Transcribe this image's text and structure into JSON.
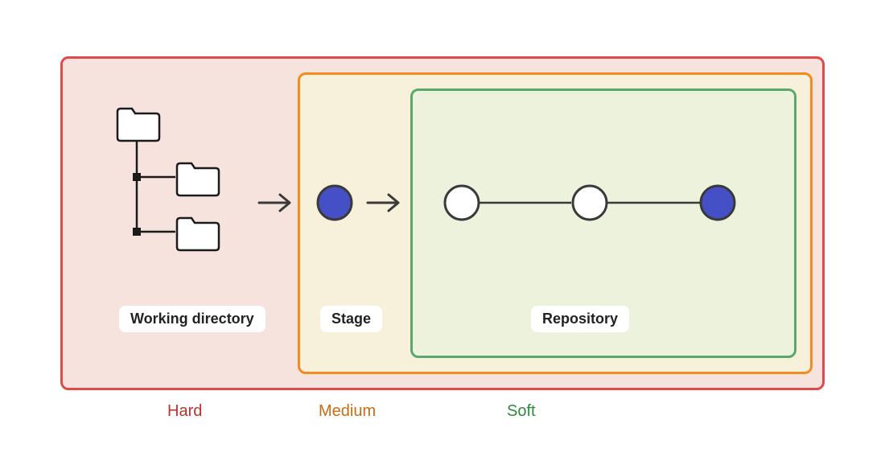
{
  "labels": {
    "working_directory": "Working directory",
    "stage": "Stage",
    "repository": "Repository"
  },
  "reset_modes": {
    "hard": {
      "name": "Hard",
      "color": "#c0312c"
    },
    "medium": {
      "name": "Medium",
      "color": "#c86b14"
    },
    "soft": {
      "name": "Soft",
      "color": "#2e8a3a"
    }
  },
  "regions": {
    "hard": {
      "border": "#e04a4a",
      "fill": "#f7e3de"
    },
    "medium": {
      "border": "#f58a1f",
      "fill": "#f7f1db"
    },
    "soft": {
      "border": "#5aa86a",
      "fill": "#edf2dc"
    }
  },
  "commit_colors": {
    "staged": "#4550c7",
    "empty": "#ffffff",
    "head": "#4550c7",
    "outline": "#3a3a3a"
  },
  "icons": {
    "folder": "folder-icon",
    "arrow": "arrow-right-icon"
  }
}
